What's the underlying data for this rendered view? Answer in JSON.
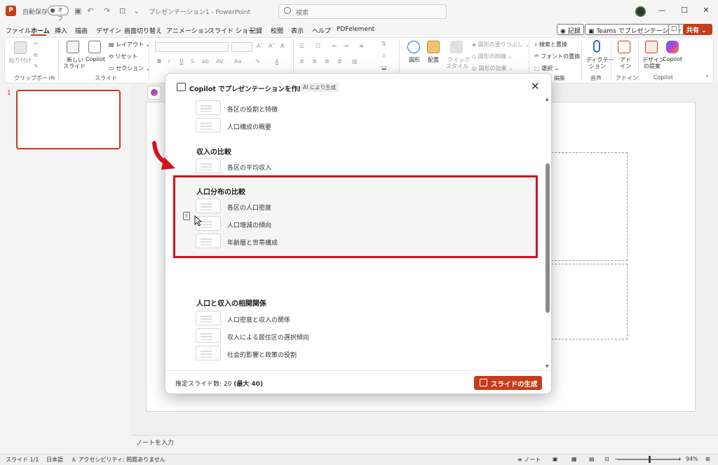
{
  "titlebar": {
    "autosave_label": "自動保存",
    "autosave_state": "オフ",
    "doc_title": "プレゼンテーション1 - PowerPoint",
    "search_placeholder": "検索"
  },
  "tabs": [
    "ファイル",
    "ホーム",
    "挿入",
    "描画",
    "デザイン",
    "画面切り替え",
    "アニメーション",
    "スライド ショー",
    "記録",
    "校閲",
    "表示",
    "ヘルプ",
    "PDFelement"
  ],
  "top_buttons": {
    "record": "記録",
    "teams": "Teams でプレゼンテーション",
    "share": "共有"
  },
  "ribbon": {
    "paste": "貼り付け",
    "clipboard": "クリップボード",
    "new_slide_1": "新しい",
    "new_slide_2": "スライド",
    "copilot_small": "Copilot",
    "layout": "レイアウト",
    "reset": "リセット",
    "section": "セクション",
    "slide_group": "スライド",
    "shape": "図形",
    "arrange": "配置",
    "quick1": "クイック",
    "quick2": "スタイル",
    "fill": "図形の塗りつぶし",
    "outline": "図形の枠線",
    "effect": "図形の効果",
    "find": "検索と置換",
    "font_replace": "フォントの置換",
    "select": "選択",
    "edit": "編集",
    "dictate1": "ディクテー",
    "dictate2": "ション",
    "voice": "音声",
    "addin1": "アド",
    "addin2": "イン",
    "addin_group": "アドイン",
    "designer1": "デザイン",
    "designer2": "の提案",
    "copilot": "Copilot",
    "copilot_group": "Copilot"
  },
  "slides_panel": {
    "number": "1"
  },
  "notes": "ノートを入力",
  "status": {
    "slide": "スライド 1/1",
    "language": "日本語",
    "accessibility": "アクセシビリティ: 問題ありません",
    "notes": "ノート",
    "zoom": "94%"
  },
  "dialog": {
    "title": "Copilot でプレゼンテーションを作成",
    "ai_tag": "AI により生成",
    "top_items": [
      "各区の役割と特徴",
      "人口構成の概要"
    ],
    "sections": [
      {
        "title": "収入の比較",
        "items": [
          "各区の平均収入"
        ]
      },
      {
        "title": "人口分布の比較",
        "items": [
          "各区の人口密度",
          "人口増減の傾向",
          "年齢層と世帯構成"
        ]
      },
      {
        "title": "人口と収入の相関関係",
        "items": [
          "人口密度と収入の関係",
          "収入による居住区の選択傾向",
          "社会的影響と政策の役割"
        ]
      }
    ],
    "estimate_label": "推定スライド数: 20 ",
    "estimate_max": "(最大 40)",
    "generate": "スライドの生成"
  },
  "colors": {
    "accent": "#c43e1c",
    "highlight": "#d3121d"
  }
}
